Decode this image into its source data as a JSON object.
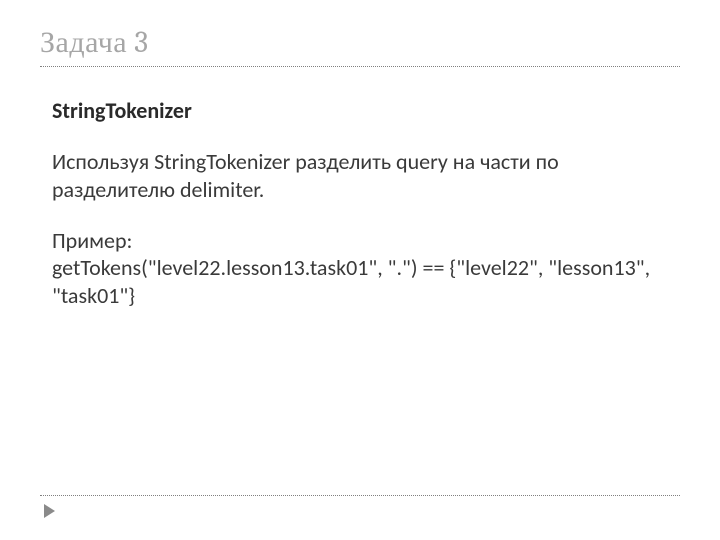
{
  "slide": {
    "title": "Задача 3",
    "subtitle": "StringTokenizer",
    "description": "Используя StringTokenizer разделить query на части по разделителю delimiter.",
    "example_label": "Пример:",
    "example_code": "getTokens(\"level22.lesson13.task01\", \".\") == {\"level22\", \"lesson13\", \"task01\"}"
  }
}
